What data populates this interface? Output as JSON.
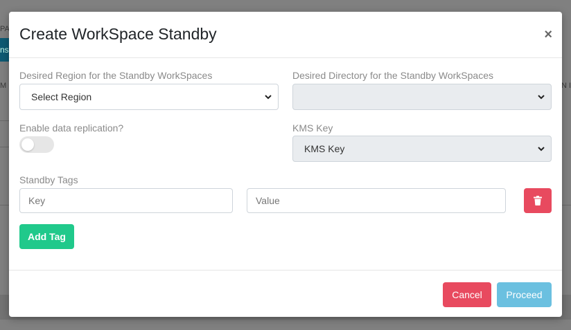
{
  "background": {
    "tab_fragment": "PA",
    "button_fragment": "ns",
    "left_fragment": "M",
    "right_fragment": "N I"
  },
  "modal": {
    "title": "Create WorkSpace Standby",
    "close_label": "×",
    "region": {
      "label": "Desired Region for the Standby WorkSpaces",
      "selected": "Select Region"
    },
    "directory": {
      "label": "Desired Directory for the Standby WorkSpaces",
      "selected": ""
    },
    "replication": {
      "label": "Enable data replication?",
      "enabled": false
    },
    "kms": {
      "label": "KMS Key",
      "selected": "KMS Key"
    },
    "tags": {
      "label": "Standby Tags",
      "key_placeholder": "Key",
      "value_placeholder": "Value",
      "add_label": "Add Tag"
    },
    "footer": {
      "cancel_label": "Cancel",
      "proceed_label": "Proceed"
    }
  },
  "colors": {
    "danger": "#e84a5f",
    "success": "#20c98b",
    "info": "#6bc0e0"
  }
}
